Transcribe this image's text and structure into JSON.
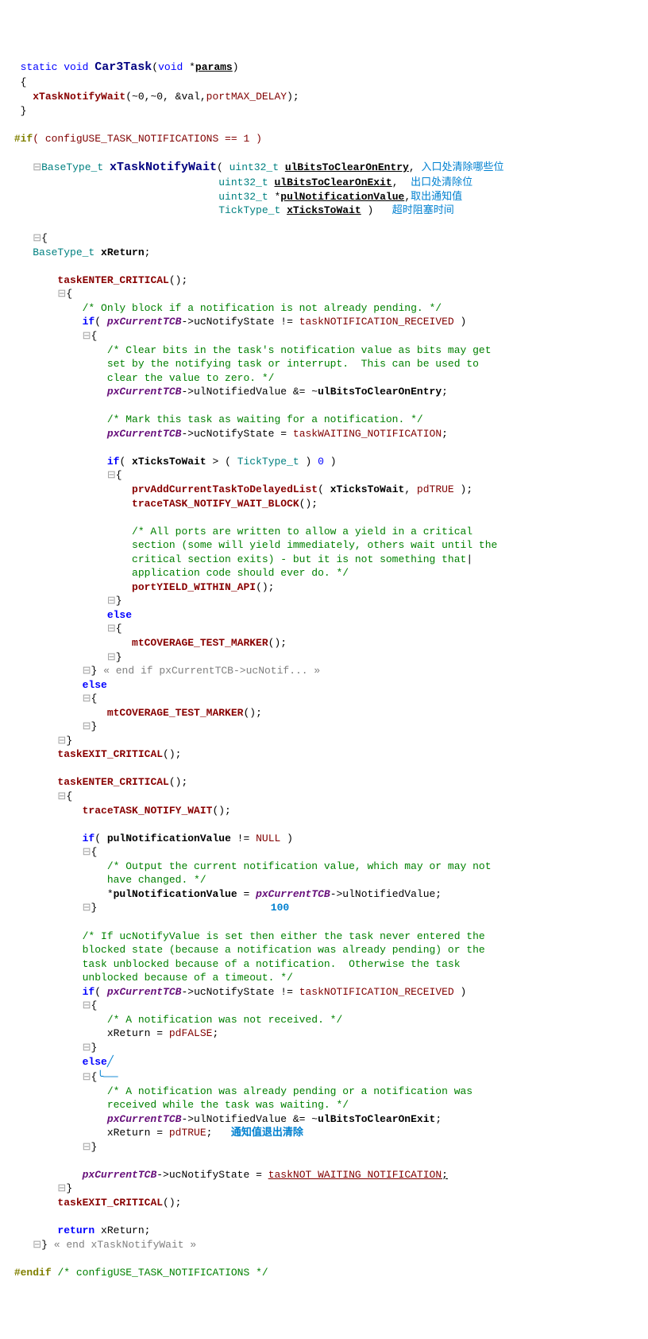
{
  "l1_static": "static",
  "l1_void": "void",
  "l1_fn": "Car3Task",
  "l1_void2": "void",
  "l1_param": "params",
  "l2": "{",
  "l3_call": "xTaskNotifyWait",
  "l3_args": "(~0,~0, &val,",
  "l3_pmd": "portMAX_DELAY",
  "l4": "}",
  "l5_pre": "#if",
  "l5_cond": "( configUSE_TASK_NOTIFICATIONS == 1 )",
  "l6_type": "BaseType_t",
  "l6_fn": "xTaskNotifyWait",
  "l6_u32": "uint32_t",
  "l6_p1": "ulBitsToClearOnEntry",
  "l6_ann": "入口处清除哪些位",
  "l7_u32": "uint32_t",
  "l7_p2": "ulBitsToClearOnExit",
  "l7_ann": "出口处清除位",
  "l8_u32": "uint32_t",
  "l8_p3": "pulNotificationValue",
  "l8_ann": "取出通知值",
  "l9_tt": "TickType_t",
  "l9_p4": "xTicksToWait",
  "l9_ann": "超时阻塞时间",
  "l10": "{",
  "l11_type": "BaseType_t",
  "l11_var": "xReturn",
  "l12_call": "taskENTER_CRITICAL",
  "l13": "{",
  "l14_c": "/* Only block if a notification is not already pending. */",
  "l15_if": "if",
  "l15_var": "pxCurrentTCB",
  "l15_mem": "->ucNotifyState != ",
  "l15_const": "taskNOTIFICATION_RECEIVED",
  "l16": "{",
  "l17_c1": "/* Clear bits in the task's notification value as bits may get",
  "l17_c2": "set by the notifying task or interrupt.  This can be used to",
  "l17_c3": "clear the value to zero. */",
  "l18_var": "pxCurrentTCB",
  "l18_mem": "->ulNotifiedValue &= ~",
  "l18_p": "ulBitsToClearOnEntry",
  "l19_c": "/* Mark this task as waiting for a notification. */",
  "l20_var": "pxCurrentTCB",
  "l20_mem": "->ucNotifyState = ",
  "l20_const": "taskWAITING_NOTIFICATION",
  "l21_if": "if",
  "l21_p": "xTicksToWait",
  "l21_tt": "TickType_t",
  "l21_zero": "0",
  "l22": "{",
  "l23_call": "prvAddCurrentTaskToDelayedList",
  "l23_p": "xTicksToWait",
  "l23_true": "pdTRUE",
  "l24_call": "traceTASK_NOTIFY_WAIT_BLOCK",
  "l25_c1": "/* All ports are written to allow a yield in a critical",
  "l25_c2": "section (some will yield immediately, others wait until the",
  "l25_c3": "critical section exits) - but it is not something that",
  "l25_c4": "application code should ever do. */",
  "l26_call": "portYIELD_WITHIN_API",
  "l27": "}",
  "l28_else": "else",
  "l29": "{",
  "l30_call": "mtCOVERAGE_TEST_MARKER",
  "l31": "}",
  "l32_close": "}",
  "l32_c": "« end if pxCurrentTCB->ucNotif... »",
  "l33_else": "else",
  "l34": "{",
  "l35_call": "mtCOVERAGE_TEST_MARKER",
  "l36": "}",
  "l37": "}",
  "l38_call": "taskEXIT_CRITICAL",
  "l39_call": "taskENTER_CRITICAL",
  "l40": "{",
  "l41_call": "traceTASK_NOTIFY_WAIT",
  "l42_if": "if",
  "l42_p": "pulNotificationValue",
  "l42_null": "NULL",
  "l43": "{",
  "l44_c1": "/* Output the current notification value, which may or may not",
  "l44_c2": "have changed. */",
  "l45_p": "pulNotificationValue",
  "l45_var": "pxCurrentTCB",
  "l45_mem": "->ulNotifiedValue;",
  "l46": "}",
  "ann_100": "100",
  "l47_c1": "/* If ucNotifyValue is set then either the task never entered the",
  "l47_c2": "blocked state (because a notification was already pending) or the",
  "l47_c3": "task unblocked because of a notification.  Otherwise the task",
  "l47_c4": "unblocked because of a timeout. */",
  "l48_if": "if",
  "l48_var": "pxCurrentTCB",
  "l48_mem": "->ucNotifyState != ",
  "l48_const": "taskNOTIFICATION_RECEIVED",
  "l49": "{",
  "l50_c": "/* A notification was not received. */",
  "l51_var": "xReturn",
  "l51_false": "pdFALSE",
  "l52": "}",
  "l53_else": "else",
  "l54": "{",
  "l55_c1": "/* A notification was already pending or a notification was",
  "l55_c2": "received while the task was waiting. */",
  "l56_var": "pxCurrentTCB",
  "l56_mem": "->ulNotifiedValue &= ~",
  "l56_p": "ulBitsToClearOnExit",
  "l57_var": "xReturn",
  "l57_true": "pdTRUE",
  "ann_exit": "通知值退出清除",
  "l58": "}",
  "l59_var": "pxCurrentTCB",
  "l59_mem": "->ucNotifyState = ",
  "l59_const": "taskNOT_WAITING_NOTIFICATION",
  "l60": "}",
  "l61_call": "taskEXIT_CRITICAL",
  "l62_ret": "return",
  "l62_var": "xReturn",
  "l63_close": "}",
  "l63_c": "« end xTaskNotifyWait »",
  "l64_endif": "#endif",
  "l64_c": "/* configUSE_TASK_NOTIFICATIONS */"
}
